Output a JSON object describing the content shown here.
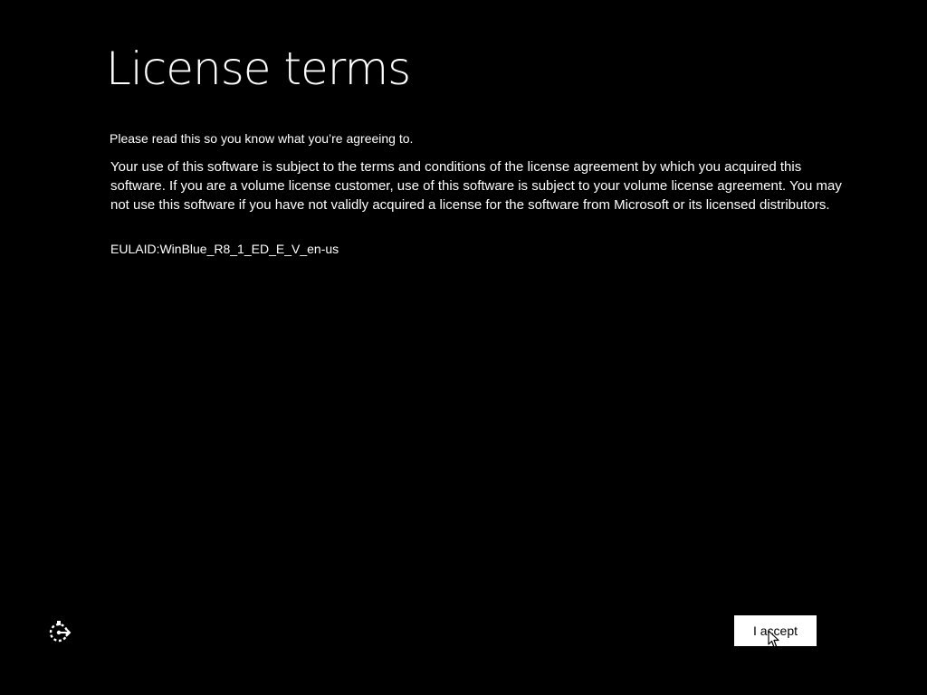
{
  "header": {
    "title": "License terms"
  },
  "content": {
    "intro": "Please read this so you know what you’re agreeing to.",
    "license_text": "Your use of this software is subject to the terms and conditions of the license agreement by which you acquired this software.  If you are a volume license customer, use of this software is subject to your volume license agreement.  You may not use this software if you have not validly acquired a license for the software from Microsoft or its licensed distributors.",
    "eula_id": "EULAID:WinBlue_R8_1_ED_E_V_en-us"
  },
  "footer": {
    "ease_of_access_icon": "ease-of-access-icon",
    "accept_label": "I accept"
  },
  "colors": {
    "background": "#000000",
    "text": "#ffffff",
    "button_background": "#ffffff",
    "button_text": "#000000"
  }
}
